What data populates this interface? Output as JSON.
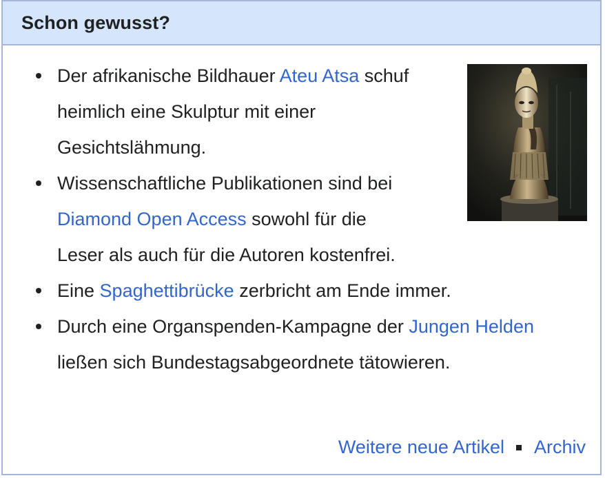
{
  "box": {
    "title": "Schon gewusst?"
  },
  "image": {
    "subject": "african-wooden-sculpture"
  },
  "facts": [
    {
      "before": "Der afrikanische Bildhauer ",
      "link": "Ateu Atsa",
      "after": " schuf heimlich eine Skulptur mit einer Gesichtslähmung."
    },
    {
      "before": "Wissenschaftliche Publikationen sind bei ",
      "link": "Diamond Open Access",
      "after": " sowohl für die Leser als auch für die Autoren kostenfrei."
    },
    {
      "before": "Eine ",
      "link": "Spaghettibrücke",
      "after": " zerbricht am Ende immer."
    },
    {
      "before": "Durch eine Organspenden-Kampagne der ",
      "link": "Jungen Helden",
      "after": " ließen sich Bundestagsabgeordnete tätowieren."
    }
  ],
  "footer": {
    "more_label": "Weitere neue Artikel",
    "archive_label": "Archiv"
  },
  "colors": {
    "header_bg": "#d5e5fb",
    "border": "#a7b5d4",
    "link": "#3366cc",
    "text": "#202122"
  }
}
